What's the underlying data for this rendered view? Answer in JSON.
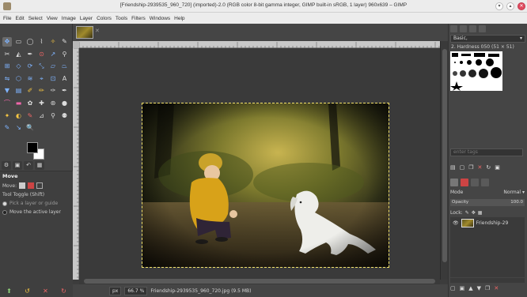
{
  "window": {
    "title": "[Friendship-2939535_960_720] (imported)-2.0 (RGB color 8-bit gamma integer, GIMP built-in sRGB, 1 layer) 960x639 – GIMP"
  },
  "menu": [
    "File",
    "Edit",
    "Select",
    "View",
    "Image",
    "Layer",
    "Colors",
    "Tools",
    "Filters",
    "Windows",
    "Help"
  ],
  "tools": [
    {
      "icon": "move-icon",
      "glyph": "✥",
      "color": "#7fb4ff"
    },
    {
      "icon": "rect-select-icon",
      "glyph": "▭",
      "color": "#ddd"
    },
    {
      "icon": "ellipse-select-icon",
      "glyph": "◯",
      "color": "#ddd"
    },
    {
      "icon": "free-select-icon",
      "glyph": "⌇",
      "color": "#ddd"
    },
    {
      "icon": "fuzzy-select-icon",
      "glyph": "✧",
      "color": "#f5c542"
    },
    {
      "icon": "color-picker-icon",
      "glyph": "✎",
      "color": "#ddd"
    },
    {
      "icon": "scissors-icon",
      "glyph": "✂",
      "color": "#ddd"
    },
    {
      "icon": "foreground-select-icon",
      "glyph": "◭",
      "color": "#ddd"
    },
    {
      "icon": "paths-icon",
      "glyph": "✒",
      "color": "#ddd"
    },
    {
      "icon": "color-picker-icon",
      "glyph": "⊙",
      "color": "#e66"
    },
    {
      "icon": "measure-icon",
      "glyph": "↗",
      "color": "#7fb4ff"
    },
    {
      "icon": "zoom-icon",
      "glyph": "⚲",
      "color": "#ddd"
    },
    {
      "icon": "align-icon",
      "glyph": "⊞",
      "color": "#7fb4ff"
    },
    {
      "icon": "transform-icon",
      "glyph": "◇",
      "color": "#7fb4ff"
    },
    {
      "icon": "rotate-icon",
      "glyph": "⟳",
      "color": "#7fb4ff"
    },
    {
      "icon": "scale-icon",
      "glyph": "⤡",
      "color": "#7fb4ff"
    },
    {
      "icon": "shear-icon",
      "glyph": "▱",
      "color": "#7fb4ff"
    },
    {
      "icon": "perspective-icon",
      "glyph": "⏢",
      "color": "#7fb4ff"
    },
    {
      "icon": "flip-icon",
      "glyph": "⇋",
      "color": "#7fb4ff"
    },
    {
      "icon": "cage-icon",
      "glyph": "⬡",
      "color": "#7fb4ff"
    },
    {
      "icon": "warp-icon",
      "glyph": "≋",
      "color": "#7fb4ff"
    },
    {
      "icon": "handle-transform-icon",
      "glyph": "⌖",
      "color": "#7fb4ff"
    },
    {
      "icon": "unified-transform-icon",
      "glyph": "⊡",
      "color": "#7fb4ff"
    },
    {
      "icon": "text-icon",
      "glyph": "A",
      "color": "#ddd"
    },
    {
      "icon": "bucket-fill-icon",
      "glyph": "▼",
      "color": "#7fb4ff"
    },
    {
      "icon": "gradient-icon",
      "glyph": "▤",
      "color": "#7fb4ff"
    },
    {
      "icon": "paintbrush-icon",
      "glyph": "✐",
      "color": "#f5c542"
    },
    {
      "icon": "pencil-icon",
      "glyph": "✏",
      "color": "#f5c542"
    },
    {
      "icon": "airbrush-icon",
      "glyph": "✑",
      "color": "#ddd"
    },
    {
      "icon": "ink-icon",
      "glyph": "✒",
      "color": "#ddd"
    },
    {
      "icon": "mypaint-brush-icon",
      "glyph": "⌒",
      "color": "#e6a"
    },
    {
      "icon": "eraser-icon",
      "glyph": "▬",
      "color": "#e6a"
    },
    {
      "icon": "clone-icon",
      "glyph": "✿",
      "color": "#ddd"
    },
    {
      "icon": "heal-icon",
      "glyph": "✚",
      "color": "#ddd"
    },
    {
      "icon": "perspective-clone-icon",
      "glyph": "⊛",
      "color": "#ddd"
    },
    {
      "icon": "blur-icon",
      "glyph": "●",
      "color": "#ddd"
    },
    {
      "icon": "smudge-icon",
      "glyph": "✦",
      "color": "#f5c542"
    },
    {
      "icon": "dodge-burn-icon",
      "glyph": "◐",
      "color": "#f5c542"
    },
    {
      "icon": "color-picker-icon",
      "glyph": "✎",
      "color": "#e66"
    },
    {
      "icon": "measure-icon",
      "glyph": "⊿",
      "color": "#ddd"
    },
    {
      "icon": "zoom-icon",
      "glyph": "⚲",
      "color": "#ddd"
    },
    {
      "icon": "warp-icon",
      "glyph": "⚉",
      "color": "#ddd"
    },
    {
      "icon": "eyedropper-icon",
      "glyph": "✎",
      "color": "#7fb4ff"
    },
    {
      "icon": "pointer-icon",
      "glyph": "↘",
      "color": "#7fb4ff"
    },
    {
      "icon": "zoom-icon",
      "glyph": "🔍",
      "color": "#ddd"
    }
  ],
  "tool_options": {
    "heading": "Move",
    "move_label": "Move:",
    "toggle_label": "Tool Toggle (Shift)",
    "option1": "Pick a layer or guide",
    "option2": "Move the active layer"
  },
  "image": {
    "tab_close": "✕"
  },
  "status": {
    "unit": "px",
    "zoom": "66.7 %",
    "file": "Friendship-2939535_960_720.jpg (9.5 MB)"
  },
  "dock": {
    "brush_preset": "Basic,",
    "brush_name": "2. Hardness 050 (51 × 51)",
    "tag_placeholder": "enter tags",
    "mode_label": "Mode",
    "mode_value": "Normal",
    "opacity_label": "Opacity",
    "opacity_value": "100.0",
    "lock_label": "Lock:",
    "layer_name": "Friendship-29"
  }
}
